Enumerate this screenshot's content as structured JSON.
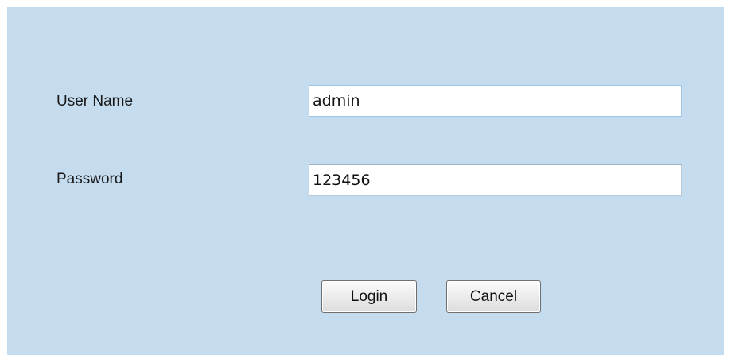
{
  "form": {
    "username_label": "User Name",
    "username_value": "admin",
    "password_label": "Password",
    "password_value": "123456",
    "login_label": "Login",
    "cancel_label": "Cancel"
  },
  "colors": {
    "panel_background": "#c5dbee",
    "field_background": "#ffffff"
  }
}
